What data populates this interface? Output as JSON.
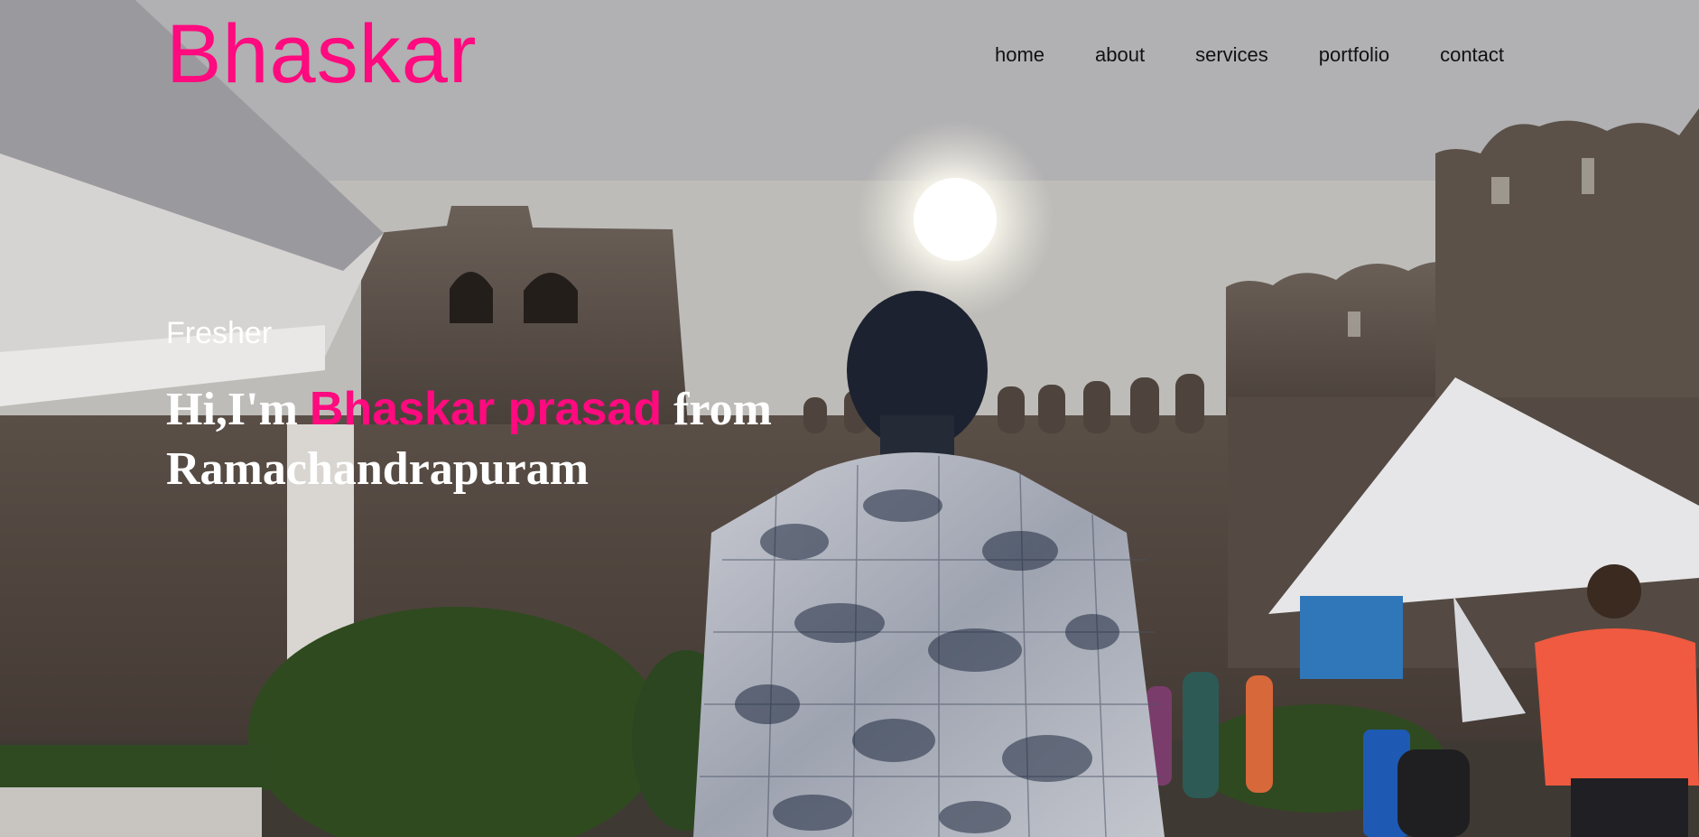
{
  "header": {
    "logo": "Bhaskar",
    "nav": [
      "home",
      "about",
      "services",
      "portfolio",
      "contact"
    ]
  },
  "hero": {
    "subtitle": "Fresher",
    "greeting": "Hi,I'm",
    "name": "Bhaskar prasad",
    "from": "from",
    "place": "Ramachandrapuram",
    "background_image": "photo of a man in a patterned shirt facing a stone fort wall under a bright sun, with tents and people"
  },
  "colors": {
    "accent": "#ff0a7f",
    "nav_text": "#111111",
    "hero_text": "#ffffff"
  }
}
